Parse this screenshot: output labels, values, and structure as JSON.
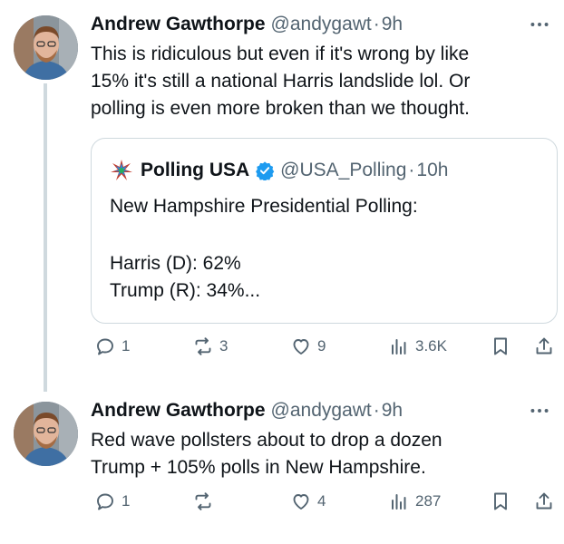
{
  "tweets": [
    {
      "author_name": "Andrew Gawthorpe",
      "handle": "@andygawt",
      "separator": "·",
      "time": "9h",
      "text_lines": [
        "This is ridiculous but even if it's wrong by like",
        "15% it's still a national Harris landslide lol. Or",
        "polling is even more broken than we thought."
      ],
      "quote": {
        "author_name": "Polling USA",
        "handle": "@USA_Polling",
        "separator": "·",
        "time": "10h",
        "lines": [
          "New Hampshire Presidential Polling:",
          "",
          "Harris (D): 62%",
          "Trump (R): 34%..."
        ]
      },
      "actions": {
        "replies": "1",
        "reposts": "3",
        "likes": "9",
        "views": "3.6K"
      }
    },
    {
      "author_name": "Andrew Gawthorpe",
      "handle": "@andygawt",
      "separator": "·",
      "time": "9h",
      "text_lines": [
        "Red wave pollsters about to drop a dozen",
        "Trump + 105% polls in New Hampshire."
      ],
      "actions": {
        "replies": "1",
        "reposts": "",
        "likes": "4",
        "views": "287"
      }
    }
  ],
  "icons": {
    "more": "more-dots-icon",
    "reply": "reply-bubble-icon",
    "repost": "repost-arrows-icon",
    "like": "heart-icon",
    "views": "views-bars-icon",
    "bookmark": "bookmark-icon",
    "share": "share-icon",
    "verified": "verified-badge-icon"
  },
  "colors": {
    "text": "#0f1419",
    "secondary": "#536471",
    "border": "#cfd9de",
    "verified": "#1d9bf0"
  }
}
